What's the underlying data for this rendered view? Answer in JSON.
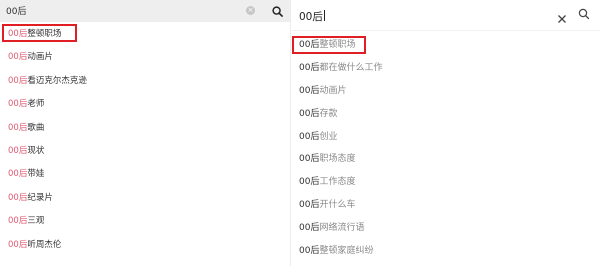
{
  "left": {
    "query": "00后",
    "items": [
      {
        "prefix": "00后",
        "rest": "整顿职场"
      },
      {
        "prefix": "00后",
        "rest": "动画片"
      },
      {
        "prefix": "00后",
        "rest": "看迈克尔杰克逊"
      },
      {
        "prefix": "00后",
        "rest": "老师"
      },
      {
        "prefix": "00后",
        "rest": "歌曲"
      },
      {
        "prefix": "00后",
        "rest": "现状"
      },
      {
        "prefix": "00后",
        "rest": "带娃"
      },
      {
        "prefix": "00后",
        "rest": "纪录片"
      },
      {
        "prefix": "00后",
        "rest": "三观"
      },
      {
        "prefix": "00后",
        "rest": "听周杰伦"
      }
    ]
  },
  "right": {
    "query": "00后",
    "items": [
      {
        "prefix": "00后",
        "rest": "整顿职场"
      },
      {
        "prefix": "00后",
        "rest": "都在做什么工作"
      },
      {
        "prefix": "00后",
        "rest": "动画片"
      },
      {
        "prefix": "00后",
        "rest": "存款"
      },
      {
        "prefix": "00后",
        "rest": "创业"
      },
      {
        "prefix": "00后",
        "rest": "职场态度"
      },
      {
        "prefix": "00后",
        "rest": "工作态度"
      },
      {
        "prefix": "00后",
        "rest": "开什么车"
      },
      {
        "prefix": "00后",
        "rest": "网络流行语"
      },
      {
        "prefix": "00后",
        "rest": "整顿家庭纠纷"
      }
    ]
  },
  "colors": {
    "highlight_box": "#e01e24",
    "left_prefix": "#e05a72",
    "right_suffix": "#8a8a8a"
  },
  "icons": {
    "left_clear": "close-circle-icon",
    "left_search": "search-icon",
    "right_clear": "close-icon",
    "right_search": "search-icon"
  }
}
